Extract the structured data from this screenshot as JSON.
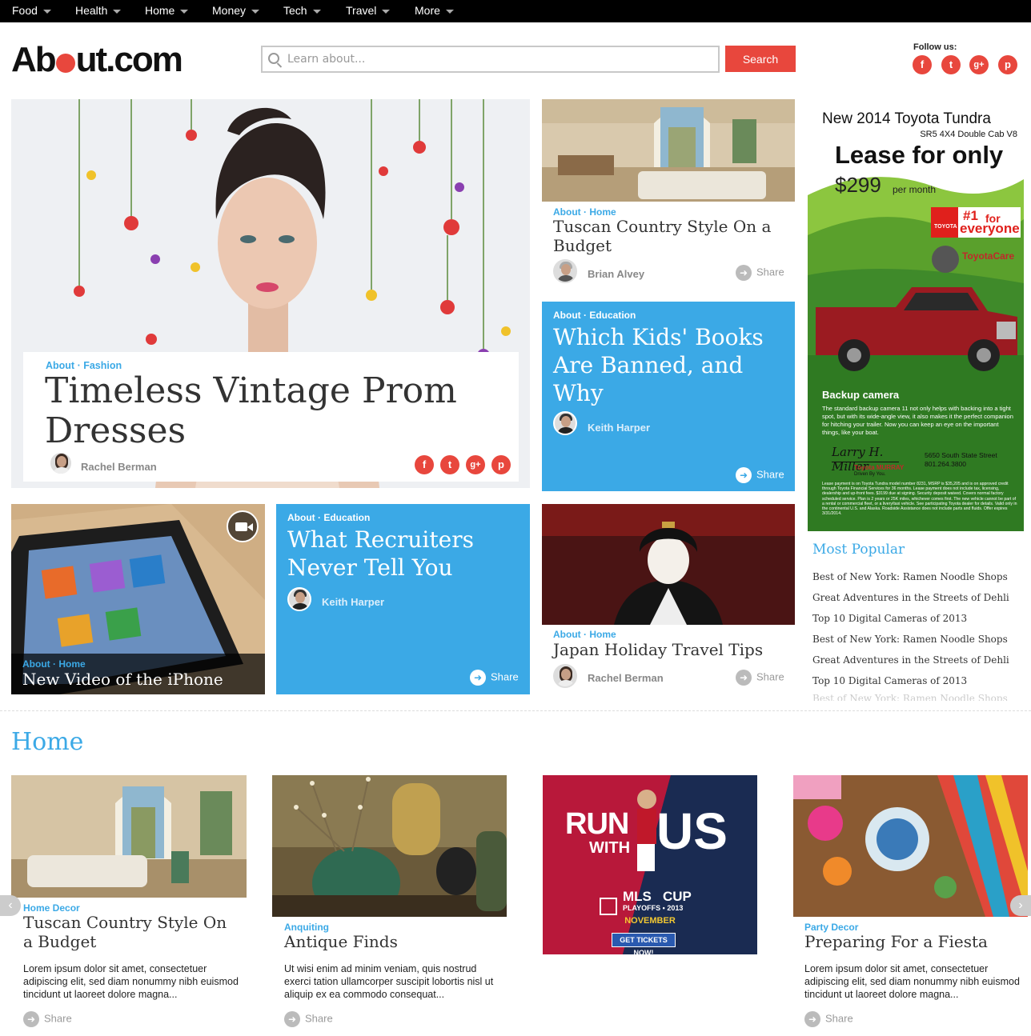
{
  "nav": {
    "items": [
      "Food",
      "Health",
      "Home",
      "Money",
      "Tech",
      "Travel",
      "More"
    ]
  },
  "header": {
    "logo_pre": "Ab",
    "logo_post": "ut.com",
    "search_placeholder": "Learn about...",
    "search_button": "Search",
    "follow_label": "Follow us:",
    "social_icons": [
      "facebook-icon",
      "twitter-icon",
      "google-plus-icon",
      "pinterest-icon"
    ],
    "social_glyphs": [
      "f",
      "t",
      "g+",
      "p"
    ]
  },
  "hero": {
    "kicker": "About · Fashion",
    "title": "Timeless Vintage Prom Dresses",
    "author": "Rachel Berman"
  },
  "card_tuscan": {
    "kicker": "About · Home",
    "title": "Tuscan Country Style On a Budget",
    "author": "Brian Alvey",
    "share": "Share"
  },
  "card_kids": {
    "kicker": "About · Education",
    "title": "Which Kids' Books Are Banned, and Why",
    "author": "Keith Harper",
    "share": "Share"
  },
  "ad_toyota": {
    "headline_model": "New 2014 Toyota Tundra",
    "subline": "SR5 4X4 Double Cab V8",
    "lease": "Lease for only",
    "price": "$299",
    "per": "per month",
    "badge_brand": "TOYOTA",
    "badge_rank": "#1",
    "badge_for": "for",
    "badge_everyone": "everyone",
    "care": "ToyotaCare",
    "camera_title": "Backup camera",
    "camera_text": "The standard backup camera 11 not only helps with backing into a tight spot, but with its wide-angle view, it also makes it the perfect companion for hitching your trailer. Now you can keep an eye on the important things, like your boat.",
    "dealer_name": "Toyota MURRAY",
    "dealer_tag": "Driven By You.",
    "address": "5650 South State Street",
    "phone": "801.264.3800",
    "fine_print": "Lease payment is on Toyota Tundra model number 8231, MSRP is $35,205 and is on approved credit through Toyota Financial Services for 36 months. Lease payment does not include tax, licensing, dealership and up-front fees. $3199 due at signing. Security deposit waived. Covers normal factory scheduled service. Plan is 2 years or 25K miles, whichever comes first. The new vehicle cannot be part of a rental or commercial fleet, or a livery/taxi vehicle. See participating Toyota dealer for details. Valid only in the continental U.S. and Alaska. Roadside Assistance does not include parts and fluids. Offer expires 3/31/2014."
  },
  "card_iphone": {
    "kicker": "About · Home",
    "title": "New Video of the iPhone"
  },
  "card_recruiters": {
    "kicker": "About · Education",
    "title": "What Recruiters Never Tell You",
    "author": "Keith Harper",
    "share": "Share"
  },
  "card_japan": {
    "kicker": "About · Home",
    "title": "Japan Holiday Travel Tips",
    "author": "Rachel Berman",
    "share": "Share"
  },
  "most_popular": {
    "title": "Most Popular",
    "items": [
      "Best of New York: Ramen Noodle Shops",
      "Great Adventures in the Streets of Dehli",
      "Top 10 Digital Cameras of 2013",
      "Best of New York: Ramen Noodle Shops",
      "Great Adventures in the Streets of Dehli",
      "Top 10 Digital Cameras of 2013",
      "Best of New York: Ramen Noodle Shops"
    ]
  },
  "home_section": {
    "title": "Home",
    "cards": [
      {
        "kicker": "Home Decor",
        "title": "Tuscan Country Style On a Budget",
        "desc": "Lorem ipsum dolor sit amet, consectetuer adipiscing elit, sed diam nonummy nibh euismod tincidunt ut laoreet dolore magna...",
        "share": "Share"
      },
      {
        "kicker": "Anquiting",
        "title": "Antique Finds",
        "desc": "Ut wisi enim ad minim veniam, quis nostrud exerci tation ullamcorper suscipit lobortis nisl ut aliquip ex ea commodo consequat...",
        "share": "Share"
      },
      {
        "kicker": "Party Decor",
        "title": "Preparing For a Fiesta",
        "desc": "Lorem ipsum dolor sit amet, consectetuer adipiscing elit, sed diam nonummy nibh euismod tincidunt ut laoreet dolore magna...",
        "share": "Share"
      }
    ],
    "ad_mls": {
      "run": "RUN",
      "with": "WITH",
      "us": "US",
      "brand": "MLS",
      "cup": "CUP",
      "playoffs": "PLAYOFFS • 2013",
      "month": "NOVEMBER",
      "cta": "GET TICKETS NOW!"
    }
  },
  "colors": {
    "accent_red": "#e8473d",
    "accent_blue": "#3ba9e6"
  }
}
